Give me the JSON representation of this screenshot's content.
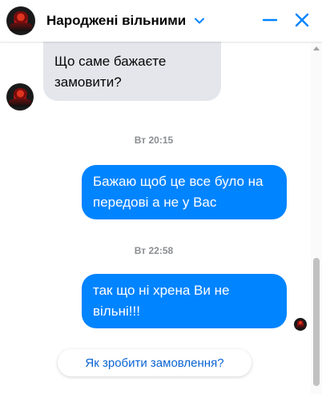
{
  "header": {
    "title": "Народжені вільними",
    "accent_color": "#0084ff",
    "icons": [
      "chevron-down-icon",
      "minimize-icon",
      "close-icon"
    ]
  },
  "messages": [
    {
      "side": "incoming",
      "text": "Що саме бажаєте замовити?"
    },
    {
      "type": "timestamp",
      "text": "Вт 20:15"
    },
    {
      "side": "outgoing",
      "text": "Бажаю щоб це все було на передові а не у Вас"
    },
    {
      "type": "timestamp",
      "text": "Вт 22:58"
    },
    {
      "side": "outgoing",
      "text": "так що ні хрена Ви не вільні!!!"
    }
  ],
  "suggestion": {
    "label": "Як зробити замовлення?"
  },
  "colors": {
    "incoming_bubble": "#e4e6eb",
    "outgoing_bubble": "#0084ff",
    "timestamp": "#8a8d91"
  }
}
